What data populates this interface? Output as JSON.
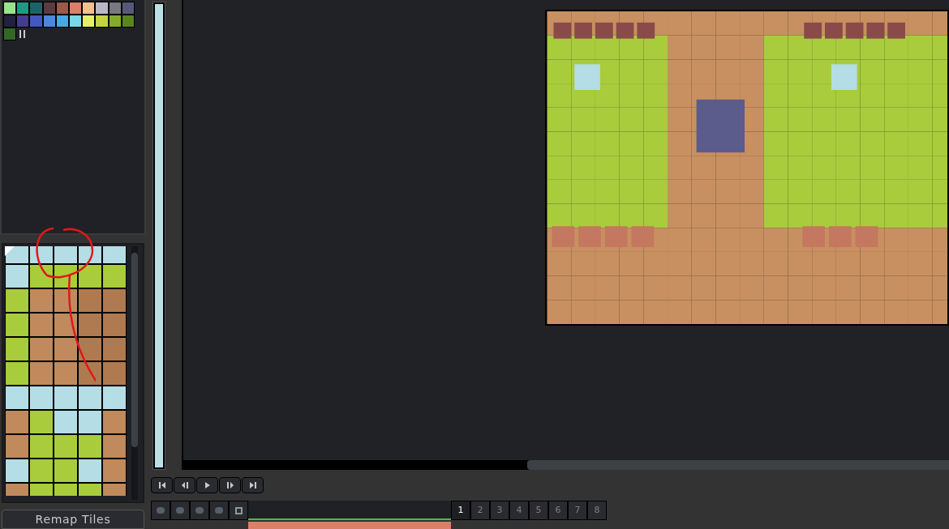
{
  "palette": {
    "swatches": [
      {
        "color": "#98e38e"
      },
      {
        "color": "#1e9a82"
      },
      {
        "color": "#1f6266"
      },
      {
        "color": "#5c3a42"
      },
      {
        "color": "#9a5a4a"
      },
      {
        "color": "#d88068"
      },
      {
        "color": "#f2c090"
      },
      {
        "color": "#bab8c8"
      },
      {
        "color": "#787880"
      },
      {
        "color": "#58587a"
      },
      {
        "color": "#22223e"
      },
      {
        "color": "#443c90"
      },
      {
        "color": "#4058c0"
      },
      {
        "color": "#4888e0"
      },
      {
        "color": "#48a8e0"
      },
      {
        "color": "#78d8e8"
      },
      {
        "color": "#e4f068"
      },
      {
        "color": "#c4d440"
      },
      {
        "color": "#84ac2c"
      },
      {
        "color": "#5a8420"
      },
      {
        "color": "#346628"
      }
    ]
  },
  "tileset": {
    "button": "Remap Tiles"
  },
  "timeline": {
    "frames": [
      {
        "label": "1",
        "selected": true
      },
      {
        "label": "2",
        "selected": false
      },
      {
        "label": "3",
        "selected": false
      },
      {
        "label": "4",
        "selected": false
      },
      {
        "label": "5",
        "selected": false
      },
      {
        "label": "6",
        "selected": false
      },
      {
        "label": "7",
        "selected": false
      },
      {
        "label": "8",
        "selected": false
      }
    ]
  }
}
